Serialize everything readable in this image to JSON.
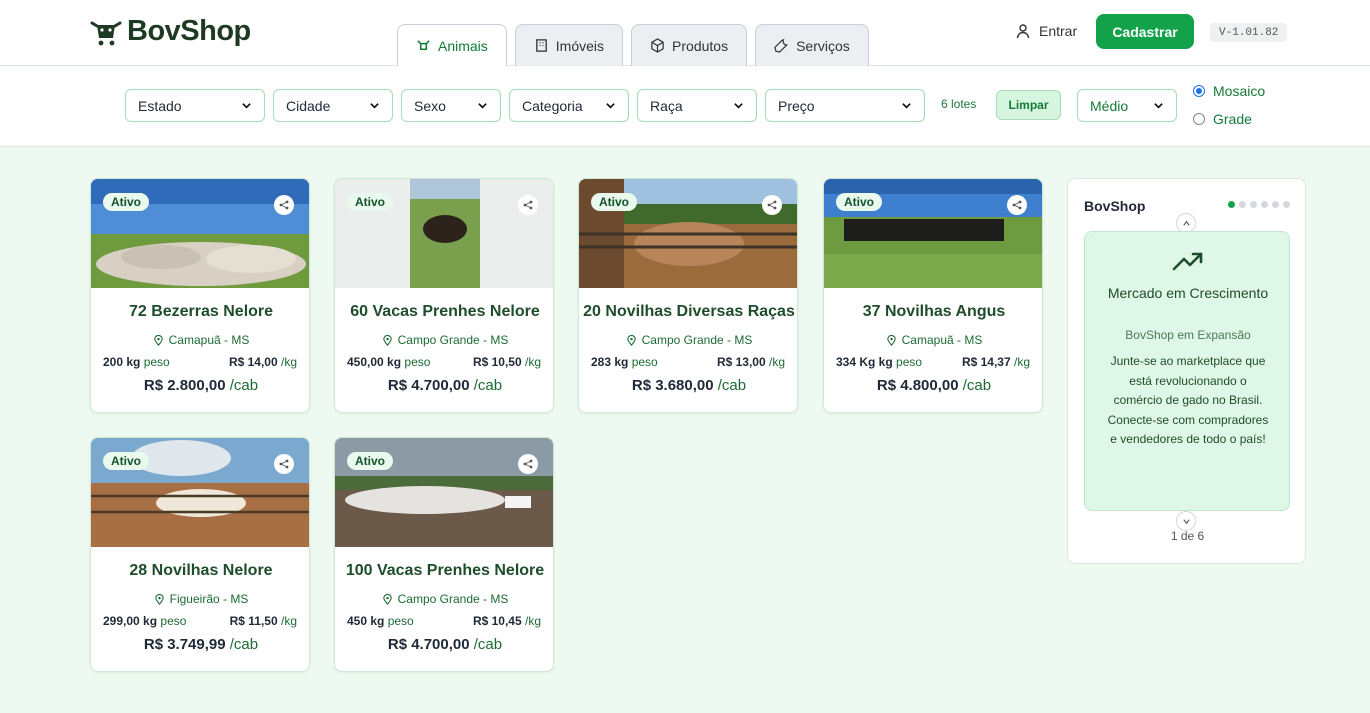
{
  "brand": {
    "name": "BovShop"
  },
  "tabs": [
    {
      "label": "Animais",
      "icon": "cow-icon",
      "active": true
    },
    {
      "label": "Imóveis",
      "icon": "building-icon",
      "active": false
    },
    {
      "label": "Produtos",
      "icon": "box-icon",
      "active": false
    },
    {
      "label": "Serviços",
      "icon": "wrench-icon",
      "active": false
    }
  ],
  "header": {
    "login_label": "Entrar",
    "signup_label": "Cadastrar",
    "version": "V-1.01.82"
  },
  "filters": {
    "estado": "Estado",
    "cidade": "Cidade",
    "sexo": "Sexo",
    "categoria": "Categoria",
    "raca": "Raça",
    "preco": "Preço",
    "count": "6 lotes",
    "clear_label": "Limpar",
    "size": "Médio",
    "view_mosaic": "Mosaico",
    "view_grid": "Grade",
    "selected_view": "Mosaico"
  },
  "listings": [
    {
      "status": "Ativo",
      "title": "72 Bezerras Nelore",
      "location": "Camapuã - MS",
      "weight": "200 kg",
      "weight_unit": "peso",
      "price_kg": "R$ 14,00",
      "price_kg_unit": "/kg",
      "price_head": "R$ 2.800,00",
      "price_head_unit": "/cab"
    },
    {
      "status": "Ativo",
      "title": "60 Vacas Prenhes Nelore",
      "location": "Campo Grande - MS",
      "weight": "450,00 kg",
      "weight_unit": "peso",
      "price_kg": "R$ 10,50",
      "price_kg_unit": "/kg",
      "price_head": "R$ 4.700,00",
      "price_head_unit": "/cab"
    },
    {
      "status": "Ativo",
      "title": "20 Novilhas Diversas Raças",
      "location": "Campo Grande - MS",
      "weight": "283 kg",
      "weight_unit": "peso",
      "price_kg": "R$ 13,00",
      "price_kg_unit": "/kg",
      "price_head": "R$ 3.680,00",
      "price_head_unit": "/cab"
    },
    {
      "status": "Ativo",
      "title": "37 Novilhas Angus",
      "location": "Camapuã - MS",
      "weight": "334 Kg kg",
      "weight_unit": "peso",
      "price_kg": "R$ 14,37",
      "price_kg_unit": "/kg",
      "price_head": "R$ 4.800,00",
      "price_head_unit": "/cab"
    },
    {
      "status": "Ativo",
      "title": "28 Novilhas Nelore",
      "location": "Figueirão - MS",
      "weight": "299,00 kg",
      "weight_unit": "peso",
      "price_kg": "R$ 11,50",
      "price_kg_unit": "/kg",
      "price_head": "R$ 3.749,99",
      "price_head_unit": "/cab"
    },
    {
      "status": "Ativo",
      "title": "100 Vacas Prenhes Nelore",
      "location": "Campo Grande - MS",
      "weight": "450 kg",
      "weight_unit": "peso",
      "price_kg": "R$ 10,45",
      "price_kg_unit": "/kg",
      "price_head": "R$ 4.700,00",
      "price_head_unit": "/cab"
    }
  ],
  "side_panel": {
    "title": "BovShop",
    "promo_heading": "Mercado em Crescimento",
    "promo_subtitle": "BovShop em Expansão",
    "promo_text": "Junte-se ao marketplace que está revolucionando o comércio de gado no Brasil. Conecte-se com compradores e vendedores de todo o país!",
    "pager": "1 de 6",
    "icon": "trending-up-icon"
  },
  "colors": {
    "accent": "#13a24a",
    "background": "#eefaf1",
    "text_green": "#1c6b35"
  }
}
